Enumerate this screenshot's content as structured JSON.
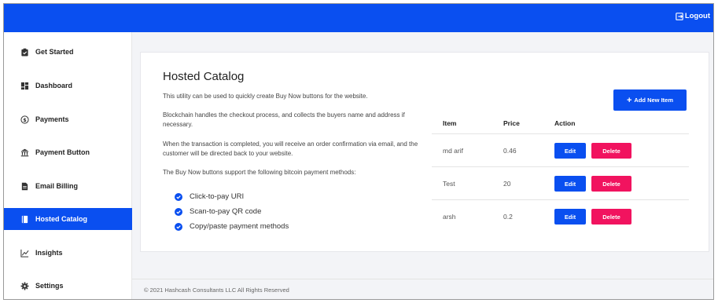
{
  "header": {
    "logout_label": "Logout"
  },
  "sidebar": {
    "items": [
      {
        "label": "Get Started",
        "icon": "clipboard-check-icon",
        "active": false
      },
      {
        "label": "Dashboard",
        "icon": "grid-icon",
        "active": false
      },
      {
        "label": "Payments",
        "icon": "dollar-circle-icon",
        "active": false
      },
      {
        "label": "Payment Button",
        "icon": "bank-icon",
        "active": false
      },
      {
        "label": "Email Billing",
        "icon": "document-icon",
        "active": false
      },
      {
        "label": "Hosted Catalog",
        "icon": "book-icon",
        "active": true
      },
      {
        "label": "Insights",
        "icon": "chart-icon",
        "active": false
      },
      {
        "label": "Settings",
        "icon": "gear-icon",
        "active": false
      }
    ]
  },
  "main": {
    "title": "Hosted Catalog",
    "paragraphs": [
      "This utility can be used to quickly create Buy Now buttons for the website.",
      "Blockchain handles the checkout process, and collects the buyers name and address if necessary.",
      "When the transaction is completed, you will receive an order confirmation via email, and the customer will be directed back to your website.",
      "The Buy Now buttons support the following bitcoin payment methods:"
    ],
    "methods": [
      "Click-to-pay URI",
      "Scan-to-pay QR code",
      "Copy/paste payment methods"
    ],
    "add_button": "Add New Item"
  },
  "table": {
    "headers": [
      "Item",
      "Price",
      "Action"
    ],
    "rows": [
      {
        "item": "md arif",
        "price": "0.46"
      },
      {
        "item": "Test",
        "price": "20"
      },
      {
        "item": "arsh",
        "price": "0.2"
      }
    ],
    "edit_label": "Edit",
    "delete_label": "Delete"
  },
  "footer": {
    "text": "© 2021 Hashcash Consultants LLC All Rights Reserved"
  },
  "colors": {
    "primary": "#0a4ff0",
    "danger": "#f1135f",
    "background": "#f3f4f7"
  }
}
